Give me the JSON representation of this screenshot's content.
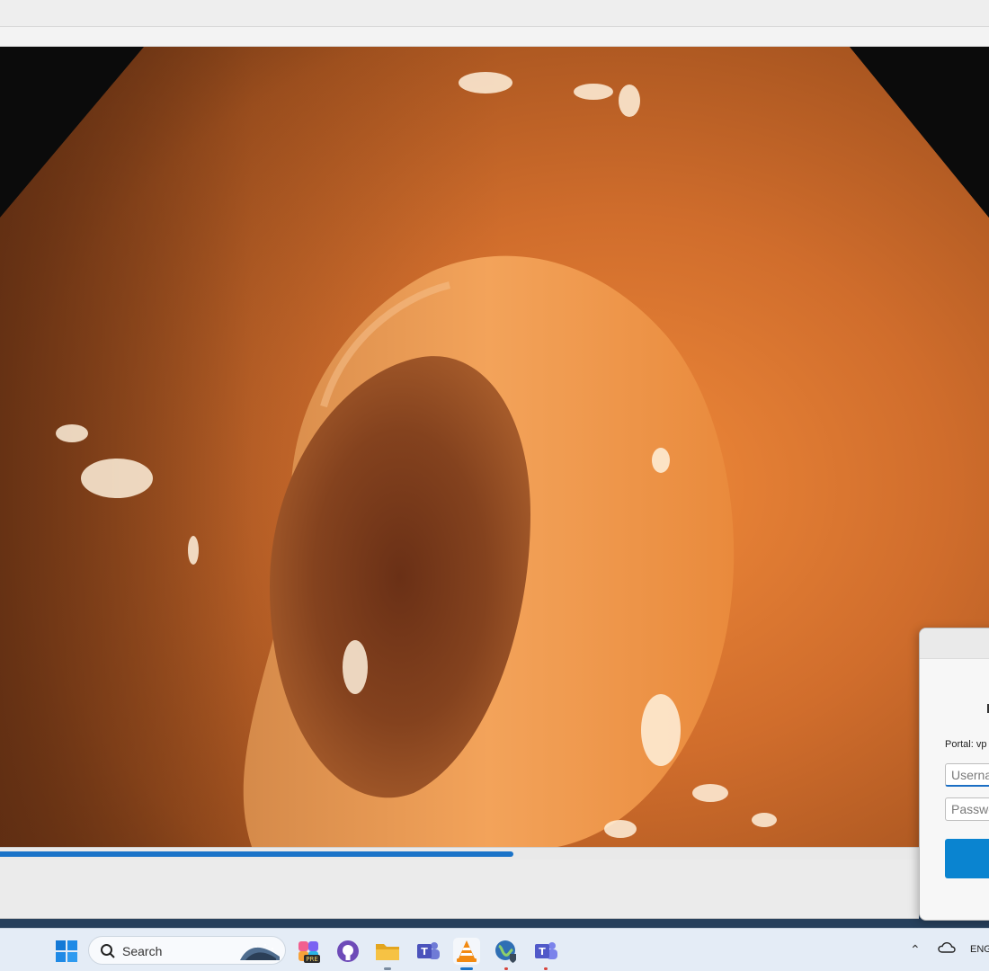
{
  "player": {
    "progress_fraction": 0.559
  },
  "login_dialog": {
    "portal_text": "Portal: vp",
    "username_placeholder": "Userna",
    "password_placeholder": "Passwo"
  },
  "taskbar": {
    "search_label": "Search",
    "apps": [
      {
        "name": "windows-start-icon"
      },
      {
        "name": "copilot-icon",
        "badge": "PRE"
      },
      {
        "name": "github-icon"
      },
      {
        "name": "file-explorer-icon"
      },
      {
        "name": "teams-icon"
      },
      {
        "name": "vlc-icon"
      },
      {
        "name": "vpn-globe-icon"
      },
      {
        "name": "teams-classic-icon"
      }
    ],
    "language": "ENG"
  },
  "colors": {
    "accent": "#1a73c8",
    "button": "#0a84d0"
  }
}
